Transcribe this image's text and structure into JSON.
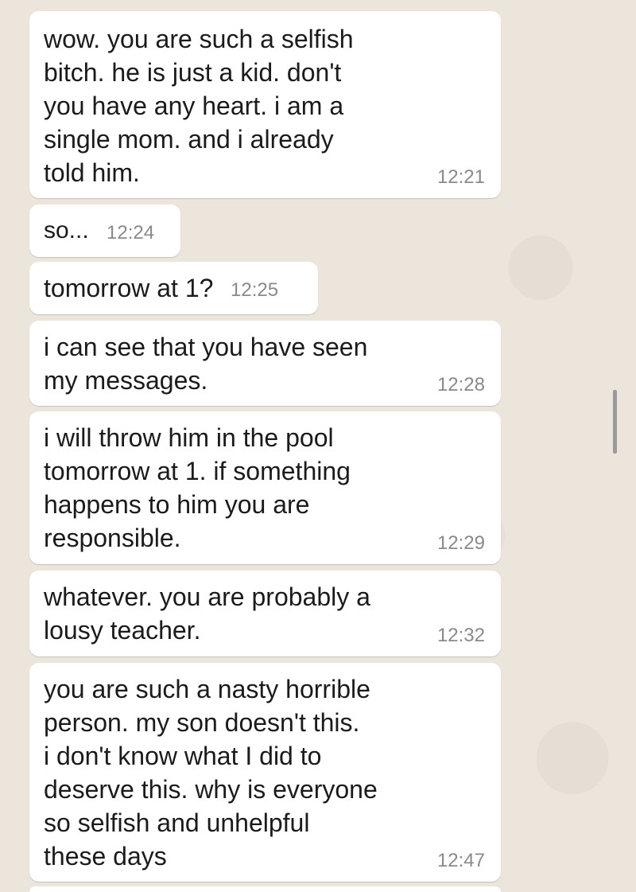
{
  "messages": [
    {
      "text": "wow. you are such a selfish\nbitch. he is just a kid. don't\nyou have any heart. i am a\nsingle mom. and i already\ntold him.",
      "time": "12:21"
    },
    {
      "text": "so...",
      "time": "12:24"
    },
    {
      "text": "tomorrow at 1?",
      "time": "12:25"
    },
    {
      "text": "i can see that you have seen\nmy messages.",
      "time": "12:28"
    },
    {
      "text": "i will throw him in the pool\ntomorrow at 1. if something\nhappens to him you are\nresponsible.",
      "time": "12:29"
    },
    {
      "text": "whatever. you are probably a\nlousy teacher.",
      "time": "12:32"
    },
    {
      "text": "you are such a nasty horrible\nperson. my son doesn't this.\ni don't know what I did to\ndeserve this. why is everyone\nso selfish and unhelpful\nthese days",
      "time": "12:47"
    }
  ]
}
